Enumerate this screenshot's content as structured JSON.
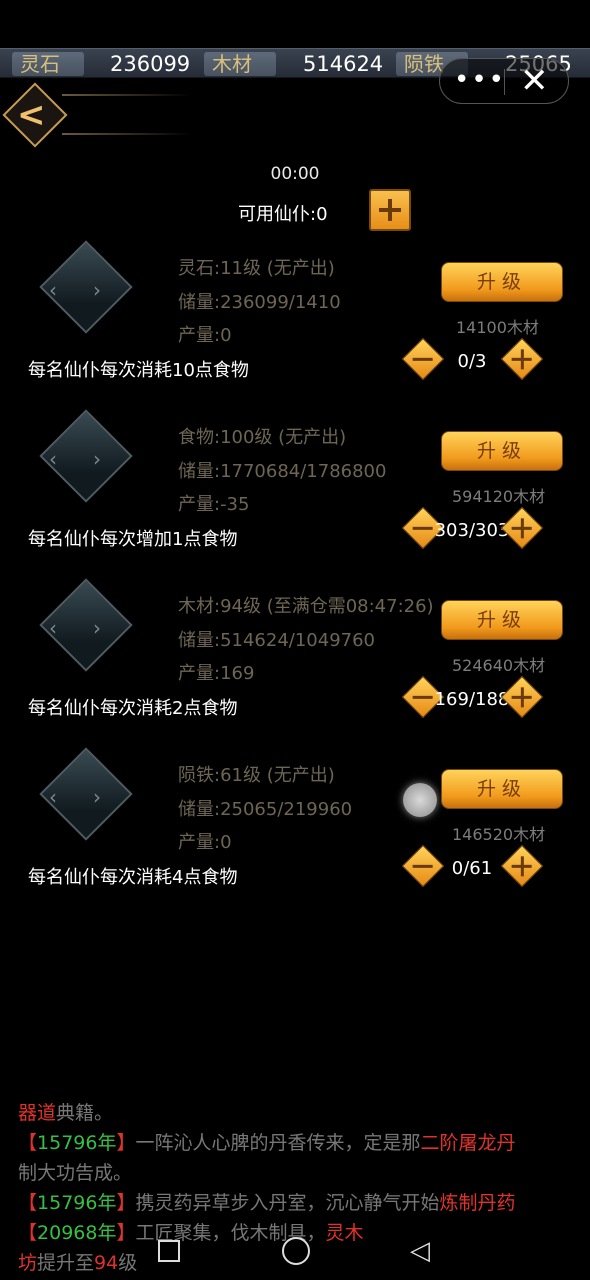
{
  "resources": [
    {
      "label": "灵石",
      "value": "236099"
    },
    {
      "label": "木材",
      "value": "514624"
    },
    {
      "label": "陨铁",
      "value": "25065"
    }
  ],
  "capsule": {
    "menu_icon": "•••",
    "close_icon": "✕"
  },
  "header": {
    "timer": "00:00",
    "available": "可用仙仆:0"
  },
  "blocks": [
    {
      "line1": "灵石:11级 (无产出)",
      "line2": "储量:236099/1410",
      "line3": "产量:0",
      "upgrade": "升级",
      "cost": "14100木材",
      "desc": "每名仙仆每次消耗10点食物",
      "count": "0/3"
    },
    {
      "line1": "食物:100级 (无产出)",
      "line2": "储量:1770684/1786800",
      "line3": "产量:-35",
      "upgrade": "升级",
      "cost": "594120木材",
      "desc": "每名仙仆每次增加1点食物",
      "count": "303/303"
    },
    {
      "line1": "木材:94级 (至满仓需08:47:26)",
      "line2": "储量:514624/1049760",
      "line3": "产量:169",
      "upgrade": "升级",
      "cost": "524640木材",
      "desc": "每名仙仆每次消耗2点食物",
      "count": "169/188"
    },
    {
      "line1": "陨铁:61级 (无产出)",
      "line2": "储量:25065/219960",
      "line3": "产量:0",
      "upgrade": "升级",
      "cost": "146520木材",
      "desc": "每名仙仆每次消耗4点食物",
      "count": "0/61"
    }
  ],
  "log": {
    "r1a": "器道",
    "r1b": "典籍。",
    "r2a": "【",
    "r2b": "15796年",
    "r2c": "】",
    "r2d": "一阵沁人心脾的丹香传来，定是那",
    "r2e": "二阶屠龙丹",
    "r3a": "制大功告成。",
    "r4a": "【",
    "r4b": "15796年",
    "r4c": "】",
    "r4d": "携灵药异草步入丹室，沉心静气开始",
    "r4e": "炼制丹药",
    "r5a": "【",
    "r5b": "20968年",
    "r5c": "】",
    "r5d": "工匠聚集，伐木制具，",
    "r5e": "灵木",
    "r6a": "坊",
    "r6b": "提升至",
    "r6c": "94",
    "r6d": "级"
  }
}
